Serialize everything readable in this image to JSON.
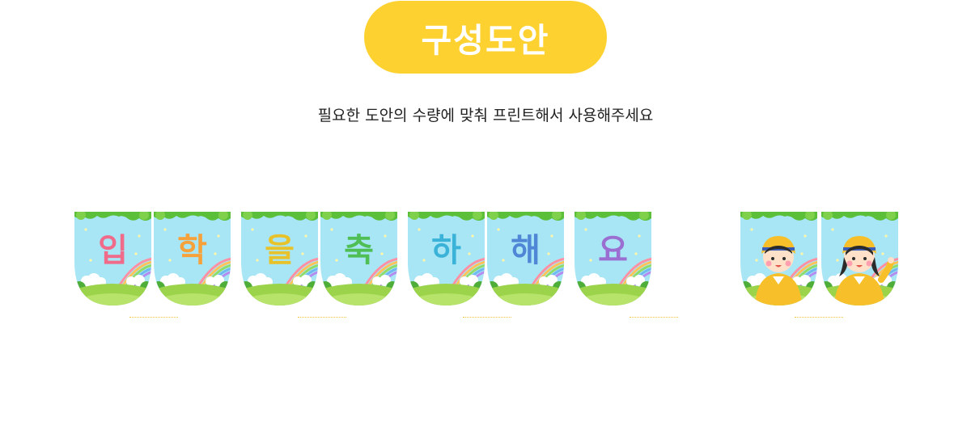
{
  "header": {
    "badge_text": "구성도안",
    "badge_color": "#fdd230",
    "subtitle": "필요한 도안의 수량에 맞춰 프린트해서 사용해주세요"
  },
  "banner": {
    "letters": [
      {
        "char": "입",
        "color": "#f06a8a"
      },
      {
        "char": "학",
        "color": "#f6a13a"
      },
      {
        "char": "을",
        "color": "#e8c22a"
      },
      {
        "char": "축",
        "color": "#4fbf55"
      },
      {
        "char": "하",
        "color": "#3bb3d8"
      },
      {
        "char": "해",
        "color": "#4f86d6"
      },
      {
        "char": "요",
        "color": "#9b6fd2"
      }
    ],
    "character_flags": [
      {
        "icon": "boy-in-yellow-raincoat-icon"
      },
      {
        "icon": "girl-in-yellow-raincoat-icon"
      }
    ],
    "colors": {
      "sky": "#a8e6f5",
      "grass": "#9bd44a",
      "tree": "#5bbf3a"
    }
  }
}
